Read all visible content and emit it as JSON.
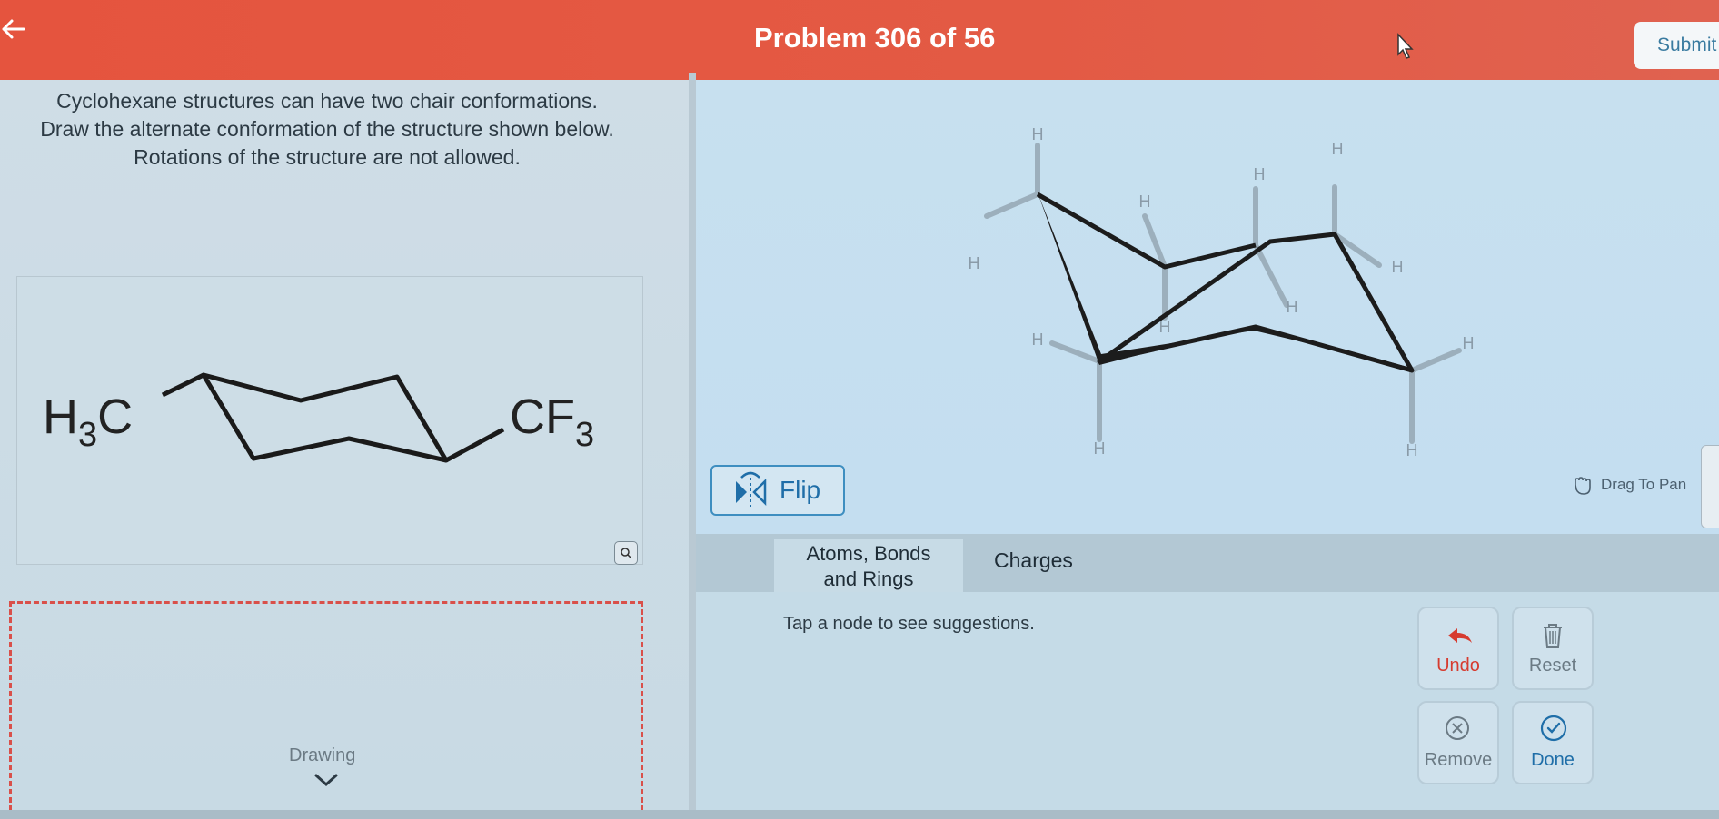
{
  "header": {
    "problem_title": "Problem 306 of 56",
    "submit_label": "Submit",
    "background": "#e5543e"
  },
  "instructions": {
    "line1": "Cyclohexane structures can have two chair conformations.",
    "line2": "Draw the alternate conformation of the structure shown below.",
    "line3": "Rotations of the structure are not allowed."
  },
  "structure": {
    "left_group_main": "H",
    "left_group_sub": "3",
    "left_group_end": "C",
    "right_group_main": "CF",
    "right_group_sub": "3"
  },
  "drawing": {
    "label": "Drawing",
    "border_color": "#d9504a"
  },
  "canvas": {
    "hydrogen_label": "H",
    "flip_label": "Flip",
    "pan_label": "Drag To Pan"
  },
  "tabs": {
    "atoms_line1": "Atoms, Bonds",
    "atoms_line2": "and Rings",
    "charges": "Charges"
  },
  "hint": "Tap a node to see suggestions.",
  "tools": {
    "undo": "Undo",
    "reset": "Reset",
    "remove": "Remove",
    "done": "Done"
  }
}
